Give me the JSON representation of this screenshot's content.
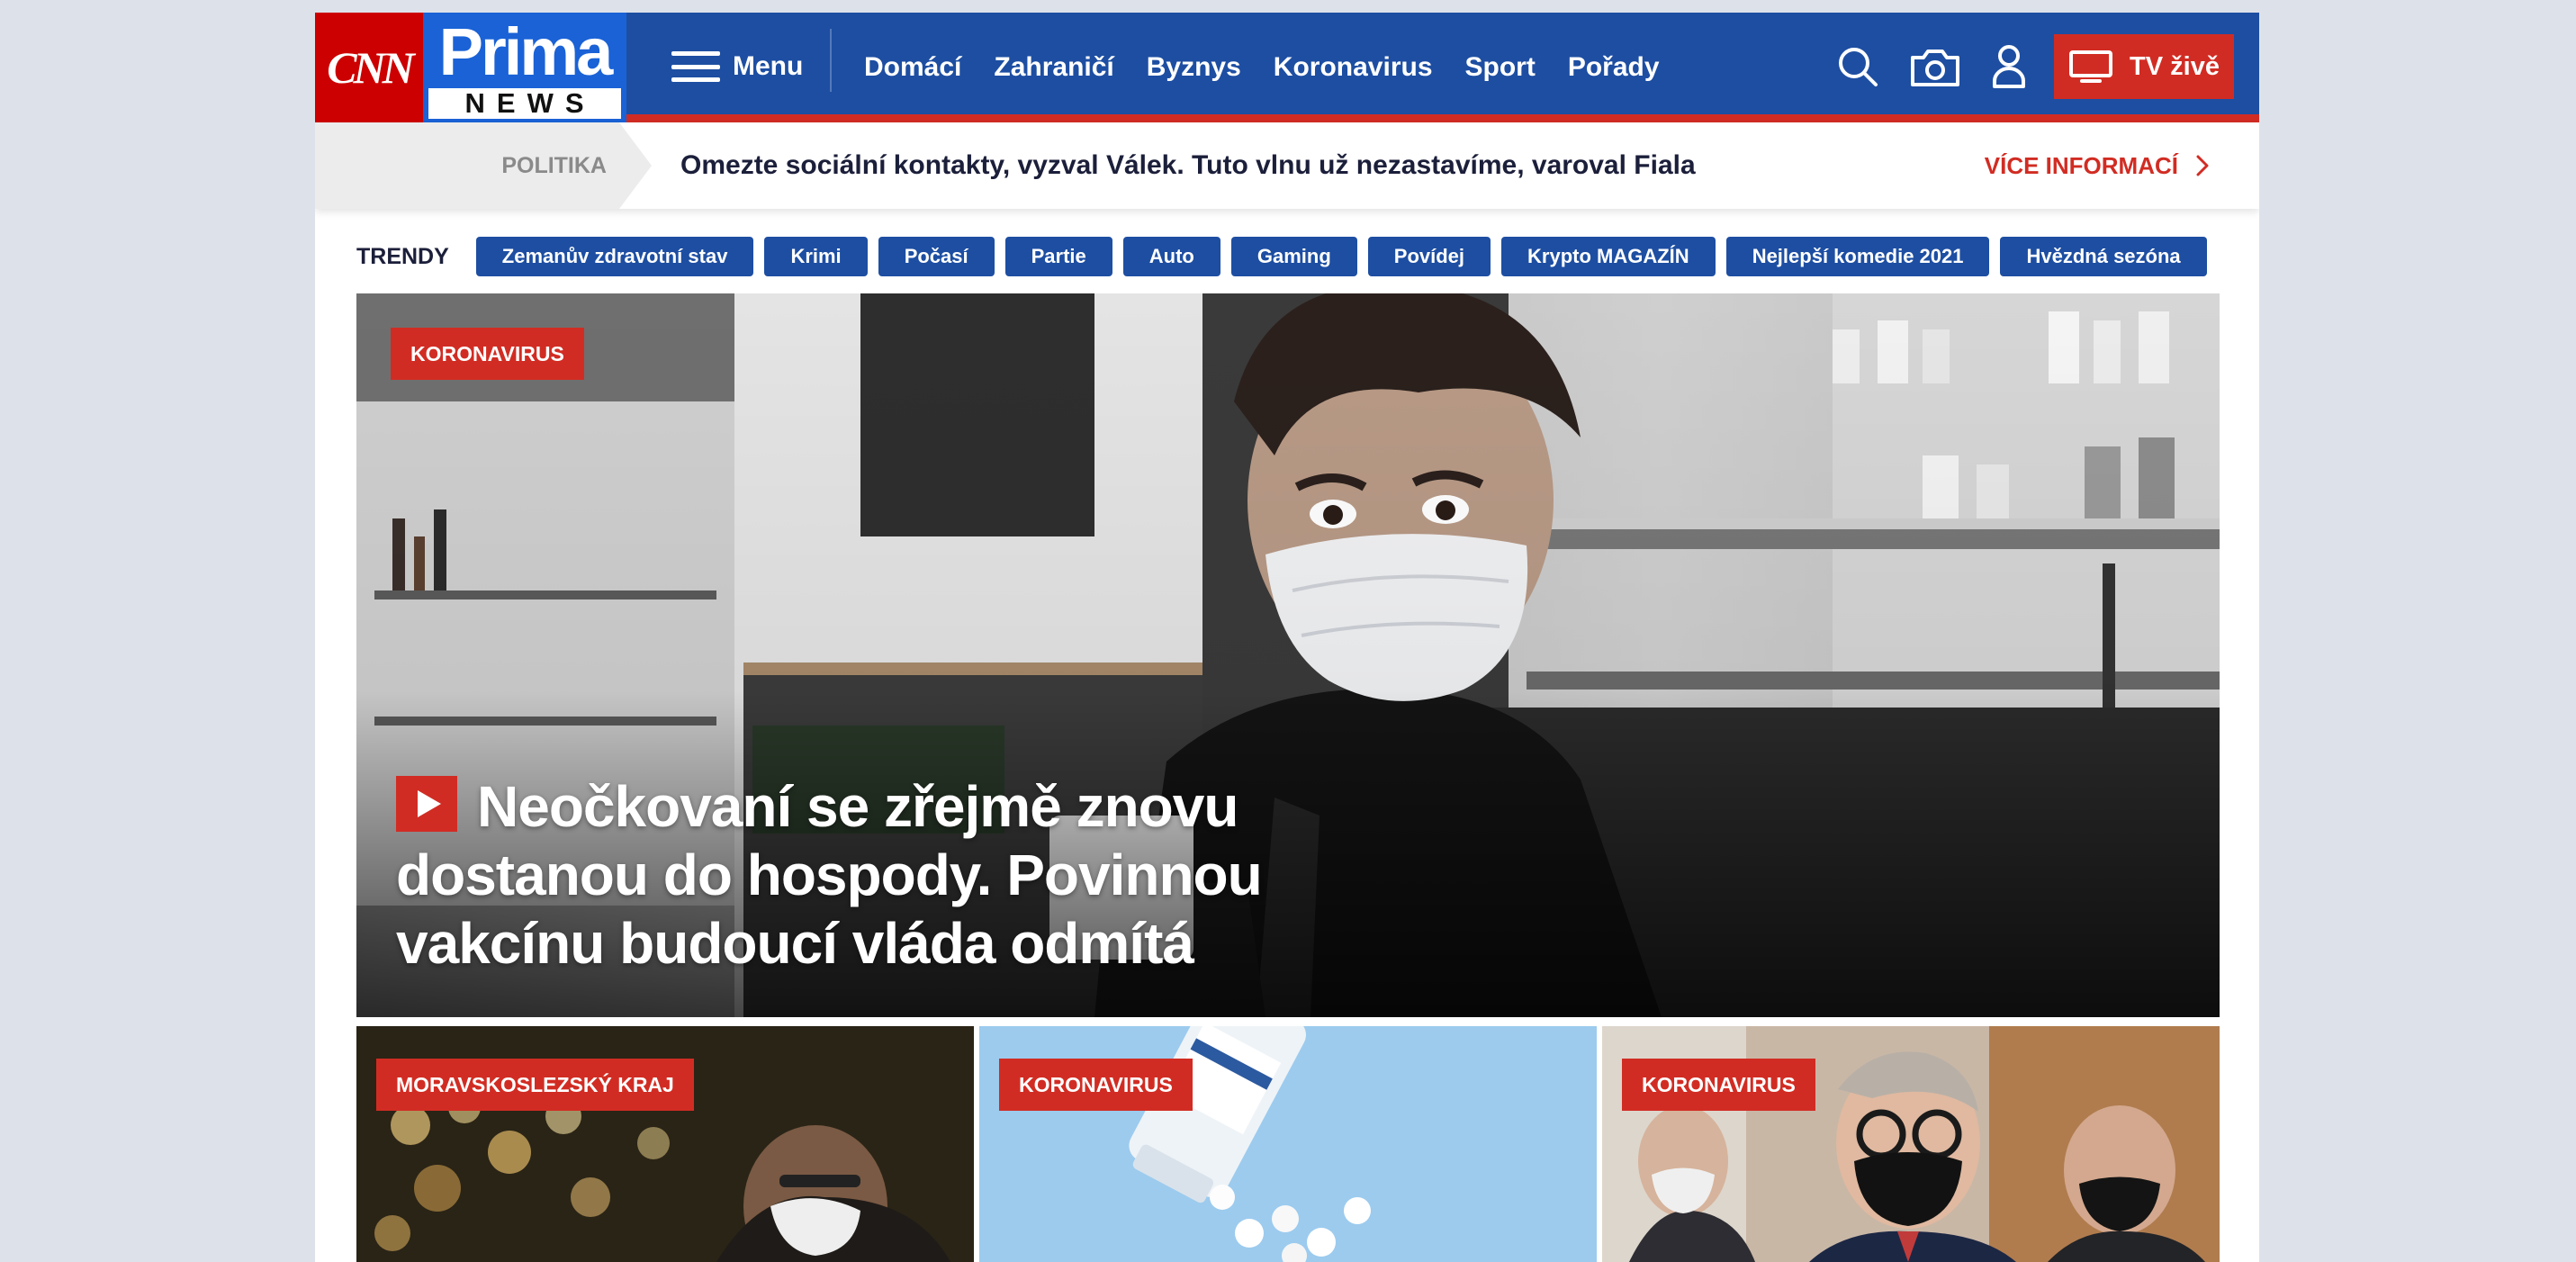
{
  "brand": {
    "cnn": "CNN",
    "prima": "Prima",
    "news": "NEWS"
  },
  "header": {
    "menu_label": "Menu",
    "nav": [
      "Domácí",
      "Zahraničí",
      "Byznys",
      "Koronavirus",
      "Sport",
      "Pořady"
    ],
    "icons": [
      "search-icon",
      "camera-icon",
      "user-icon",
      "tv-icon"
    ],
    "tv_label": "TV živě",
    "colors": {
      "bar": "#1d4ea2",
      "accent": "#d12c23"
    }
  },
  "breaking": {
    "category": "POLITIKA",
    "text": "Omezte sociální kontakty, vyzval Válek. Tuto vlnu už nezastavíme, varoval Fiala",
    "more": "VÍCE INFORMACÍ"
  },
  "trends": {
    "label": "TRENDY",
    "items": [
      "Zemanův zdravotní stav",
      "Krimi",
      "Počasí",
      "Partie",
      "Auto",
      "Gaming",
      "Povídej",
      "Krypto MAGAZÍN",
      "Nejlepší komedie 2021",
      "Hvězdná sezóna"
    ]
  },
  "hero": {
    "tag": "KORONAVIRUS",
    "title": "Neočkovaní se zřejmě znovu dostanou do hospody. Povinnou vakcínu budoucí vláda odmítá",
    "has_video": true
  },
  "cards": [
    {
      "tag": "MORAVSKOSLEZSKÝ KRAJ"
    },
    {
      "tag": "KORONAVIRUS"
    },
    {
      "tag": "KORONAVIRUS"
    }
  ]
}
